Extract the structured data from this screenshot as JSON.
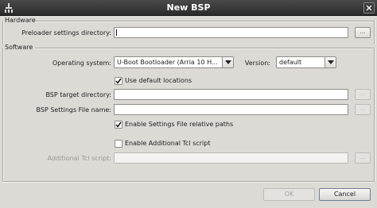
{
  "window": {
    "title": "New BSP"
  },
  "hardware": {
    "group_label": "Hardware",
    "preloader_label": "Preloader settings directory:",
    "preloader_value": "",
    "browse_label": "..."
  },
  "software": {
    "group_label": "Software",
    "os_label": "Operating system:",
    "os_value": "U-Boot Bootloader (Arria 10 H...",
    "version_label": "Version:",
    "version_value": "default",
    "use_default_locations": {
      "label": "Use default locations",
      "checked": true
    },
    "target_dir_label": "BSP target directory:",
    "target_dir_value": "",
    "settings_file_label": "BSP Settings File name:",
    "settings_file_value": "",
    "relative_paths": {
      "label": "Enable Settings File relative paths",
      "checked": true
    },
    "additional_tcl": {
      "label": "Enable Additional Tcl script",
      "checked": false
    },
    "tcl_label": "Additional Tcl script:",
    "tcl_value": "",
    "browse_label": "..."
  },
  "buttons": {
    "ok": "OK",
    "cancel": "Cancel"
  }
}
